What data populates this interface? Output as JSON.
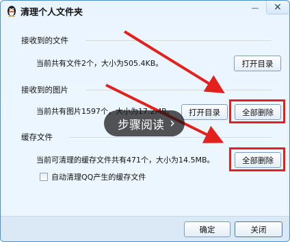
{
  "window": {
    "title": "清理个人文件夹",
    "minimize_glyph": "—",
    "close_glyph": "✕"
  },
  "received_files": {
    "section_title": "接收到的文件",
    "info": "当前共有文件2个，大小为505.4KB。",
    "open_button": "打开目录"
  },
  "received_images": {
    "section_title": "接收到的图片",
    "info": "当前共有图片1597个，大小为17.2MB。",
    "open_button": "打开目录",
    "delete_button": "全部删除"
  },
  "cache": {
    "section_title": "缓存文件",
    "info": "当前可清理的缓存文件共有471个，大小为14.5MB。",
    "delete_button": "全部删除",
    "auto_clean_label": "自动清理QQ产生的缓存文件",
    "auto_clean_checked": false
  },
  "footer": {
    "ok_button": "确定",
    "close_button": "关闭"
  },
  "overlay": {
    "guide_label": "步骤阅读",
    "highlight_color": "#e3211c"
  }
}
